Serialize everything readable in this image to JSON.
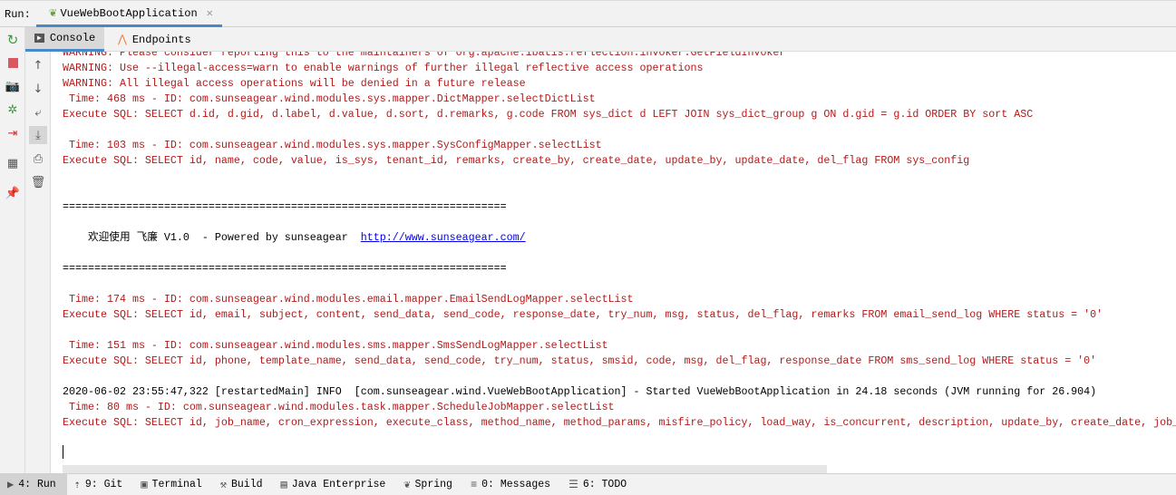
{
  "run_label": "Run:",
  "run_tab": {
    "label": "VueWebBootApplication"
  },
  "subtabs": [
    {
      "label": "Console"
    },
    {
      "label": "Endpoints"
    }
  ],
  "console_lines": [
    {
      "text": "WARNING: Please consider reporting this to the maintainers of org.apache.ibatis.reflection.invoker.GetFieldInvoker",
      "kind": "red"
    },
    {
      "text": "WARNING: Use --illegal-access=warn to enable warnings of further illegal reflective access operations",
      "kind": "red"
    },
    {
      "text": "WARNING: All illegal access operations will be denied in a future release",
      "kind": "red"
    },
    {
      "text": " Time: 468 ms - ID: com.sunseagear.wind.modules.sys.mapper.DictMapper.selectDictList",
      "kind": "red"
    },
    {
      "text": "Execute SQL: SELECT d.id, d.gid, d.label, d.value, d.sort, d.remarks, g.code FROM sys_dict d LEFT JOIN sys_dict_group g ON d.gid = g.id ORDER BY sort ASC",
      "kind": "red"
    },
    {
      "text": "",
      "kind": "red"
    },
    {
      "text": " Time: 103 ms - ID: com.sunseagear.wind.modules.sys.mapper.SysConfigMapper.selectList",
      "kind": "red"
    },
    {
      "text": "Execute SQL: SELECT id, name, code, value, is_sys, tenant_id, remarks, create_by, create_date, update_by, update_date, del_flag FROM sys_config",
      "kind": "red"
    },
    {
      "text": "",
      "kind": "blk"
    },
    {
      "text": "",
      "kind": "blk"
    },
    {
      "text": "======================================================================",
      "kind": "blk"
    },
    {
      "text": "",
      "kind": "blk"
    },
    {
      "text": "    欢迎使用 飞廉 V1.0  - Powered by sunseagear  ",
      "kind": "blk",
      "link": "http://www.sunseagear.com/"
    },
    {
      "text": "",
      "kind": "blk"
    },
    {
      "text": "======================================================================",
      "kind": "blk"
    },
    {
      "text": "",
      "kind": "blk"
    },
    {
      "text": " Time: 174 ms - ID: com.sunseagear.wind.modules.email.mapper.EmailSendLogMapper.selectList",
      "kind": "red"
    },
    {
      "text": "Execute SQL: SELECT id, email, subject, content, send_data, send_code, response_date, try_num, msg, status, del_flag, remarks FROM email_send_log WHERE status = '0'",
      "kind": "red"
    },
    {
      "text": "",
      "kind": "red"
    },
    {
      "text": " Time: 151 ms - ID: com.sunseagear.wind.modules.sms.mapper.SmsSendLogMapper.selectList",
      "kind": "red"
    },
    {
      "text": "Execute SQL: SELECT id, phone, template_name, send_data, send_code, try_num, status, smsid, code, msg, del_flag, response_date FROM sms_send_log WHERE status = '0'",
      "kind": "red"
    },
    {
      "text": "",
      "kind": "red"
    },
    {
      "text": "2020-06-02 23:55:47,322 [restartedMain] INFO  [com.sunseagear.wind.VueWebBootApplication] - Started VueWebBootApplication in 24.18 seconds (JVM running for 26.904)",
      "kind": "blk"
    },
    {
      "text": " Time: 80 ms - ID: com.sunseagear.wind.modules.task.mapper.ScheduleJobMapper.selectList",
      "kind": "red"
    },
    {
      "text": "Execute SQL: SELECT id, job_name, cron_expression, execute_class, method_name, method_params, misfire_policy, load_way, is_concurrent, description, update_by, create_date, job_",
      "kind": "red"
    }
  ],
  "bottom_tabs": [
    {
      "label": "4: Run",
      "icon": "run-icon"
    },
    {
      "label": "9: Git",
      "icon": "git-icon"
    },
    {
      "label": "Terminal",
      "icon": "terminal-icon"
    },
    {
      "label": "Build",
      "icon": "hammer-icon"
    },
    {
      "label": "Java Enterprise",
      "icon": "java-enterprise-icon"
    },
    {
      "label": "Spring",
      "icon": "spring-leaf-icon"
    },
    {
      "label": "0: Messages",
      "icon": "messages-icon"
    },
    {
      "label": "6: TODO",
      "icon": "todo-icon"
    }
  ],
  "colors": {
    "error_text": "#b21a1a",
    "accent": "#4a88c7",
    "link": "#0000ee"
  }
}
